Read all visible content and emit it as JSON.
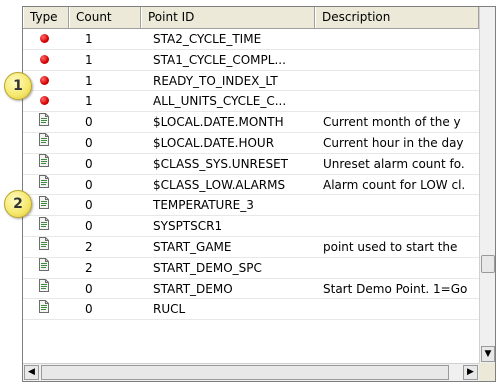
{
  "columns": [
    "Type",
    "Count",
    "Point ID",
    "Description"
  ],
  "rows": [
    {
      "type": "red-dot-icon",
      "count": "1",
      "point_id": "STA2_CYCLE_TIME",
      "description": ""
    },
    {
      "type": "red-dot-icon",
      "count": "1",
      "point_id": "STA1_CYCLE_COMPL...",
      "description": ""
    },
    {
      "type": "red-dot-icon",
      "count": "1",
      "point_id": "READY_TO_INDEX_LT",
      "description": ""
    },
    {
      "type": "red-dot-icon",
      "count": "1",
      "point_id": "ALL_UNITS_CYCLE_C...",
      "description": ""
    },
    {
      "type": "document-icon",
      "count": "0",
      "point_id": "$LOCAL.DATE.MONTH",
      "description": "Current month of the y"
    },
    {
      "type": "document-icon",
      "count": "0",
      "point_id": "$LOCAL.DATE.HOUR",
      "description": "Current hour in the day"
    },
    {
      "type": "document-icon",
      "count": "0",
      "point_id": "$CLASS_SYS.UNRESET",
      "description": "Unreset alarm count fo."
    },
    {
      "type": "document-icon",
      "count": "0",
      "point_id": "$CLASS_LOW.ALARMS",
      "description": "Alarm count for LOW cl."
    },
    {
      "type": "document-icon",
      "count": "0",
      "point_id": "TEMPERATURE_3",
      "description": ""
    },
    {
      "type": "document-icon",
      "count": "0",
      "point_id": "SYSPTSCR1",
      "description": ""
    },
    {
      "type": "document-icon",
      "count": "2",
      "point_id": "START_GAME",
      "description": "point used to start the"
    },
    {
      "type": "document-icon",
      "count": "2",
      "point_id": "START_DEMO_SPC",
      "description": ""
    },
    {
      "type": "document-icon",
      "count": "0",
      "point_id": "START_DEMO",
      "description": "Start Demo Point. 1=Go"
    },
    {
      "type": "document-icon",
      "count": "0",
      "point_id": "RUCL",
      "description": ""
    }
  ],
  "callouts": [
    "1",
    "2"
  ],
  "scrollbar": {
    "down_arrow": "▼",
    "left_arrow": "◀",
    "right_arrow": "▶"
  },
  "colors": {
    "alarm_dot": "#d40000",
    "callout": "#f5e76a",
    "header_bg": "#ece9d8"
  }
}
